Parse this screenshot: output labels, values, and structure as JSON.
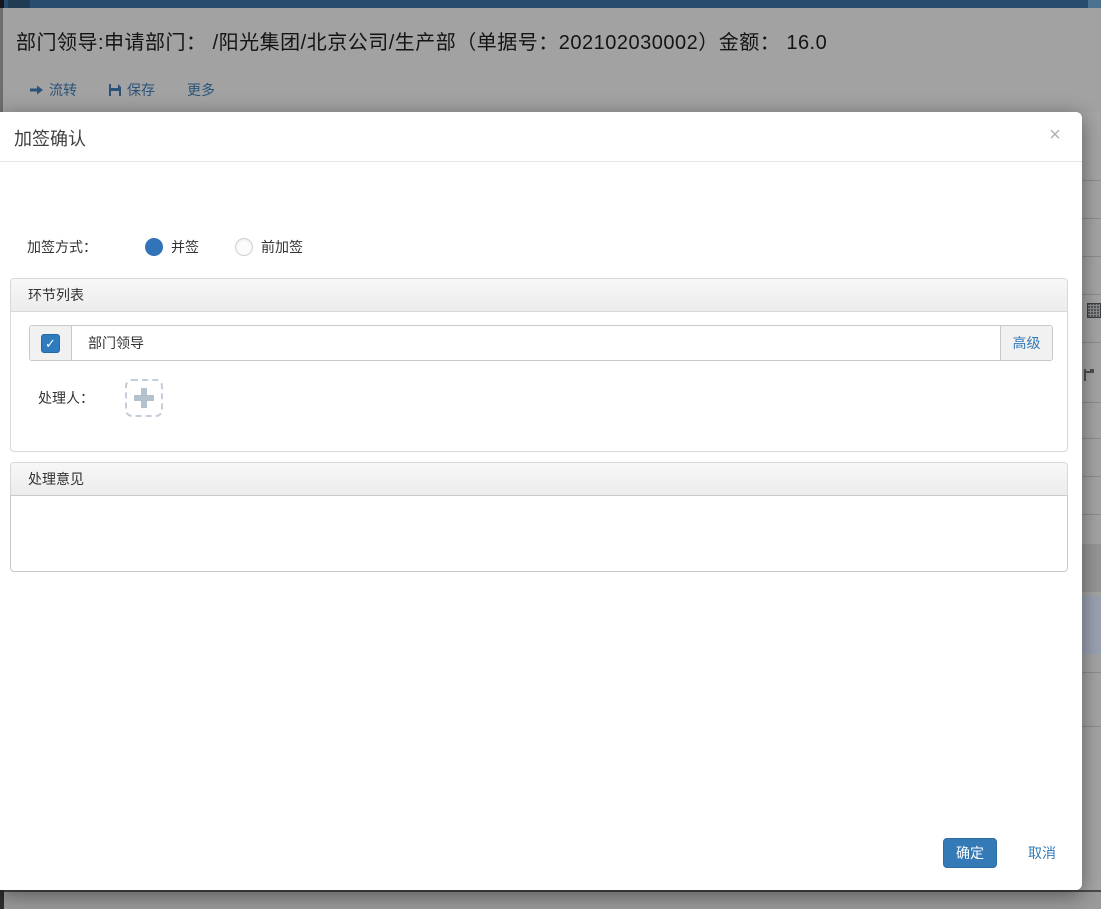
{
  "colors": {
    "accent_blue": "#337ab7",
    "radio_blue": "#3273b9",
    "checkbox_blue": "#2f7bbf",
    "topbar_navy": "#274c6d",
    "backdrop_gray": "#a2a2a2"
  },
  "page": {
    "title": "部门领导:申请部门： /阳光集团/北京公司/生产部（单据号：202102030002）金额： 16.0",
    "toolbar": {
      "items": [
        {
          "label": "流转",
          "icon": "arrow-right-icon"
        },
        {
          "label": "保存",
          "icon": "floppy-disk-icon"
        },
        {
          "label": "更多",
          "icon": ""
        }
      ]
    }
  },
  "modal": {
    "title": "加签确认",
    "close_icon": "×",
    "method": {
      "label": "加签方式：",
      "options": [
        {
          "label": "并签",
          "selected": true
        },
        {
          "label": "前加签",
          "selected": false
        }
      ]
    },
    "steps_panel": {
      "title": "环节列表",
      "rows": [
        {
          "checked": true,
          "check_icon": "✓",
          "name": "部门领导",
          "advanced_label": "高级"
        }
      ],
      "handler_label": "处理人：",
      "add_icon": "plus-icon"
    },
    "comment_panel": {
      "title": "处理意见",
      "value": ""
    },
    "footer": {
      "ok_label": "确定",
      "cancel_label": "取消"
    }
  }
}
